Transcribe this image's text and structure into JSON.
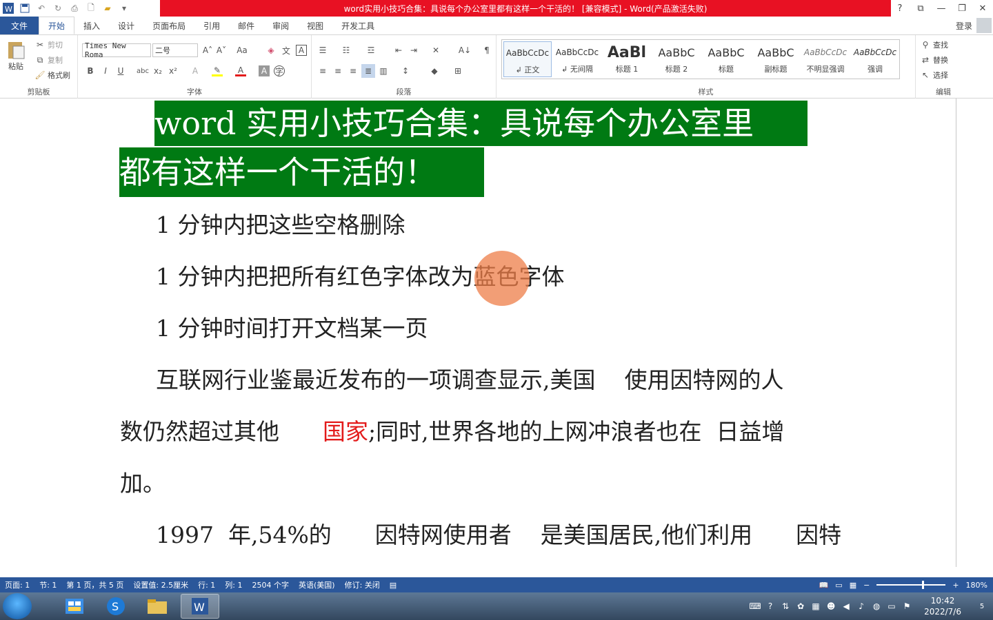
{
  "window": {
    "title": "word实用小技巧合集：具说每个办公室里都有这样一个干活的！ [兼容模式] - Word(产品激活失败)",
    "help": "?",
    "restore": "⧉",
    "minimize": "—",
    "maximize": "❐",
    "close": "✕"
  },
  "tabs": {
    "file": "文件",
    "home": "开始",
    "insert": "插入",
    "design": "设计",
    "layout": "页面布局",
    "references": "引用",
    "mailings": "邮件",
    "review": "审阅",
    "view": "视图",
    "developer": "开发工具",
    "login": "登录"
  },
  "clipboard": {
    "paste": "粘贴",
    "cut": "剪切",
    "copy": "复制",
    "format_painter": "格式刷",
    "group": "剪贴板"
  },
  "font": {
    "name": "Times New Roma",
    "size": "二号",
    "group": "字体"
  },
  "paragraph": {
    "group": "段落"
  },
  "styles": {
    "group": "样式",
    "items": [
      {
        "sample": "AaBbCcDc",
        "name": "↲ 正文"
      },
      {
        "sample": "AaBbCcDc",
        "name": "↲ 无间隔"
      },
      {
        "sample": "AaBl",
        "name": "标题 1"
      },
      {
        "sample": "AaBbC",
        "name": "标题 2"
      },
      {
        "sample": "AaBbC",
        "name": "标题"
      },
      {
        "sample": "AaBbC",
        "name": "副标题"
      },
      {
        "sample": "AaBbCcDc",
        "name": "不明显强调"
      },
      {
        "sample": "AaBbCcDc",
        "name": "强调"
      }
    ]
  },
  "editing": {
    "find": "查找",
    "replace": "替换",
    "select": "选择",
    "group": "编辑"
  },
  "document": {
    "title_line1": "word 实用小技巧合集：具说每个办公室里",
    "title_line2": "都有这样一个干活的！",
    "item1": "1 分钟内把这些空格删除",
    "item2_pre": "1 分钟内把把所有红色字体改为",
    "item2_post": "蓝色字体",
    "item3": "1 分钟时间打开文档某一页",
    "para1_l1": "互联网行业鉴最近发布的一项调查显示,美国    使用因特网的人",
    "para1_l2_pre": "数仍然超过其他      ",
    "para1_l2_red": "国家",
    "para1_l2_post": ";同时,世界各地的上网冲浪者也在  日益增",
    "para1_l3": "加。",
    "para2_l1": "1997  年,54%的      因特网使用者    是美国居民,他们利用      因特"
  },
  "status": {
    "page": "页面: 1",
    "section": "节: 1",
    "page_of": "第 1 页，共 5 页",
    "setting": "设置值: 2.5厘米",
    "row": "行: 1",
    "col": "列: 1",
    "words": "2504 个字",
    "lang": "英语(美国)",
    "track": "修订: 关闭",
    "zoom": "180%"
  },
  "taskbar": {
    "time": "10:42",
    "date": "2022/7/6",
    "notif": "5"
  },
  "colors": {
    "accent": "#2b579a",
    "title_red": "#e81123",
    "title_green": "#007a13",
    "red_text": "#e31b1b",
    "cursor": "#ed7d48"
  }
}
